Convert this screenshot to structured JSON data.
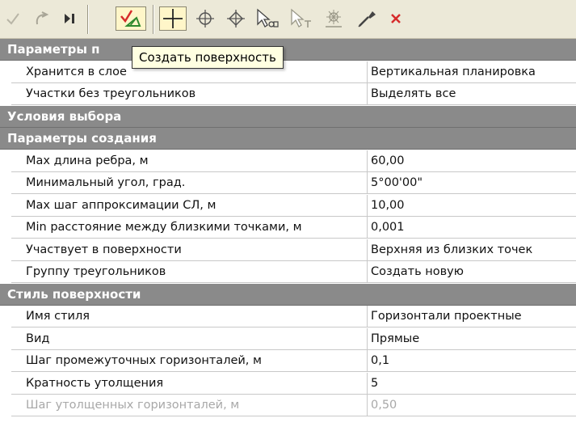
{
  "tooltip": "Создать поверхность",
  "toolbar": {
    "icons": [
      "check-icon",
      "undo-icon",
      "step-to-end-icon",
      "create-surface-icon",
      "crosshair-icon",
      "circle-cross-icon",
      "diamond-cross-icon",
      "select-pointer-icon",
      "text-pointer-icon",
      "point-target-icon",
      "eyedropper-icon",
      "close-x-icon"
    ],
    "pressed": "create-surface-icon",
    "accent_red": "#d62b2b",
    "accent_green": "#2f8a2f"
  },
  "grid": {
    "colors": {
      "section_bg": "#8a8a8a",
      "section_text": "#ffffff",
      "disabled_text": "#a8a8a8"
    },
    "sections": [
      {
        "title": "Параметры п",
        "rows": [
          {
            "name": "Хранится в слое",
            "value": "Вертикальная планировка"
          },
          {
            "name": "Участки без треугольников",
            "value": "Выделять все"
          }
        ]
      },
      {
        "title": "Условия выбора",
        "rows": []
      },
      {
        "title": "Параметры создания",
        "rows": [
          {
            "name": "Max длина ребра, м",
            "value": "60,00"
          },
          {
            "name": "Минимальный угол, град.",
            "value": "5°00'00\""
          },
          {
            "name": "Max шаг аппроксимации СЛ, м",
            "value": "10,00"
          },
          {
            "name": "Min расстояние между близкими точками, м",
            "value": "0,001"
          },
          {
            "name": "Участвует в поверхности",
            "value": "Верхняя из близких точек"
          },
          {
            "name": "Группу треугольников",
            "value": "Создать новую"
          }
        ]
      },
      {
        "title": "Стиль поверхности",
        "rows": [
          {
            "name": "Имя стиля",
            "value": "Горизонтали проектные"
          },
          {
            "name": "Вид",
            "value": "Прямые"
          },
          {
            "name": "Шаг промежуточных горизонталей, м",
            "value": "0,1"
          },
          {
            "name": "Кратность утолщения",
            "value": "5"
          },
          {
            "name": "Шаг утолщенных горизонталей, м",
            "value": "0,50",
            "disabled": true
          }
        ]
      }
    ]
  }
}
